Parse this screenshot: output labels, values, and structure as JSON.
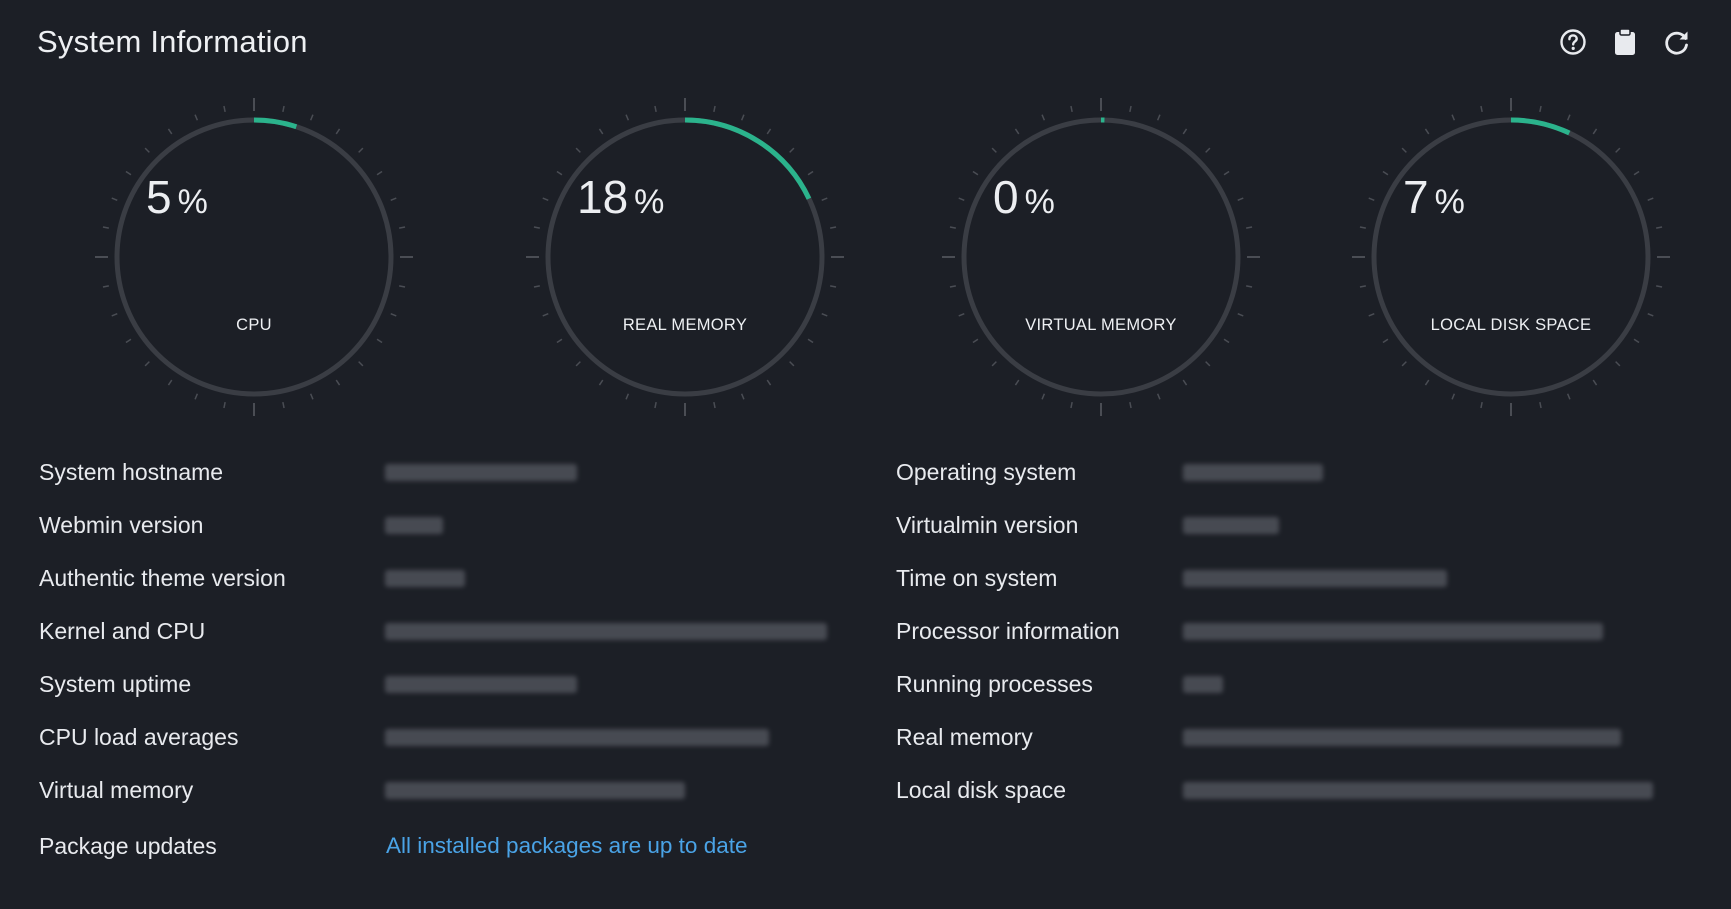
{
  "header": {
    "title": "System Information",
    "help_icon": "question-circle-icon",
    "copy_icon": "clipboard-icon",
    "refresh_icon": "refresh-icon"
  },
  "colors": {
    "background": "#1c1f26",
    "gauge_track": "#3a3d44",
    "gauge_fill": "#2bb38c",
    "link": "#4aa3e6"
  },
  "gauges": [
    {
      "value": "5",
      "unit": "%",
      "label": "CPU",
      "percent": 5
    },
    {
      "value": "18",
      "unit": "%",
      "label": "REAL MEMORY",
      "percent": 18
    },
    {
      "value": "0",
      "unit": "%",
      "label": "VIRTUAL MEMORY",
      "percent": 0
    },
    {
      "value": "7",
      "unit": "%",
      "label": "LOCAL DISK SPACE",
      "percent": 7
    }
  ],
  "info_left": [
    {
      "label": "System hostname"
    },
    {
      "label": "Webmin version"
    },
    {
      "label": "Authentic theme version"
    },
    {
      "label": "Kernel and CPU"
    },
    {
      "label": "System uptime"
    },
    {
      "label": "CPU load averages"
    },
    {
      "label": "Virtual memory"
    },
    {
      "label": "Package updates",
      "link": "All installed packages are up to date"
    }
  ],
  "info_right": [
    {
      "label": "Operating system"
    },
    {
      "label": "Virtualmin version"
    },
    {
      "label": "Time on system"
    },
    {
      "label": "Processor information"
    },
    {
      "label": "Running processes"
    },
    {
      "label": "Real memory"
    },
    {
      "label": "Local disk space"
    }
  ]
}
